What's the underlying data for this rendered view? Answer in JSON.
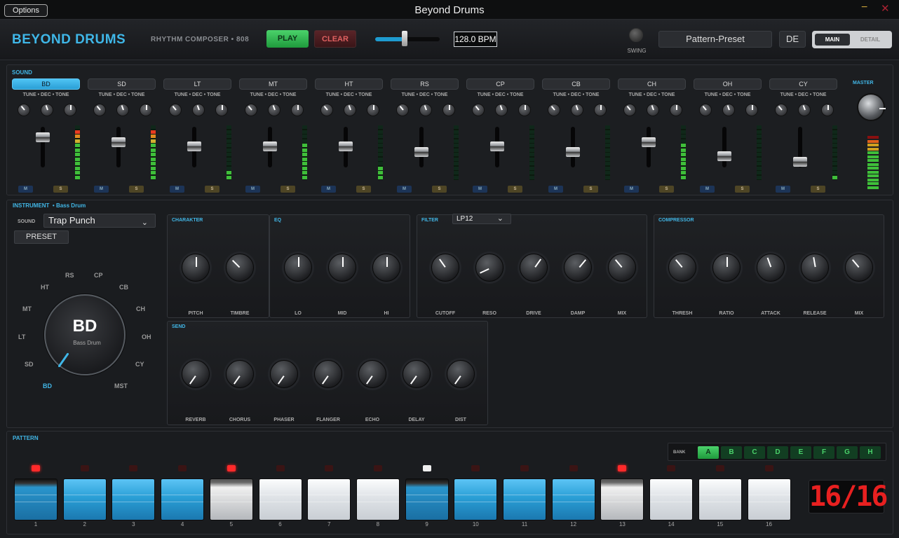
{
  "window": {
    "title": "Beyond Drums",
    "options_label": "Options",
    "minimize_glyph": "−",
    "close_glyph": "✕"
  },
  "header": {
    "brand": "BEYOND DRUMS",
    "subtitle": "RHYTHM COMPOSER • 808",
    "play_label": "PLAY",
    "clear_label": "CLEAR",
    "tempo_fraction": 0.43,
    "bpm": "128.0 BPM",
    "swing_label": "SWING",
    "preset": "Pattern-Preset",
    "language": "DE",
    "mode_main": "MAIN",
    "mode_detail": "DETAIL"
  },
  "sound": {
    "title": "SOUND",
    "knob_labels": "TUNE • DEC • TONE",
    "mute_label": "M",
    "solo_label": "S",
    "master_label": "MASTER",
    "channels": [
      {
        "name": "BD",
        "active": true,
        "fader": 0.85,
        "meter": 0.95
      },
      {
        "name": "SD",
        "active": false,
        "fader": 0.72,
        "meter": 0.9
      },
      {
        "name": "LT",
        "active": false,
        "fader": 0.62,
        "meter": 0.15
      },
      {
        "name": "MT",
        "active": false,
        "fader": 0.62,
        "meter": 0.7
      },
      {
        "name": "HT",
        "active": false,
        "fader": 0.62,
        "meter": 0.25
      },
      {
        "name": "RS",
        "active": false,
        "fader": 0.47,
        "meter": 0
      },
      {
        "name": "CP",
        "active": false,
        "fader": 0.62,
        "meter": 0
      },
      {
        "name": "CB",
        "active": false,
        "fader": 0.47,
        "meter": 0
      },
      {
        "name": "CH",
        "active": false,
        "fader": 0.72,
        "meter": 0.65
      },
      {
        "name": "OH",
        "active": false,
        "fader": 0.35,
        "meter": 0
      },
      {
        "name": "CY",
        "active": false,
        "fader": 0.2,
        "meter": 0.08
      }
    ]
  },
  "instrument": {
    "title": "INSTRUMENT",
    "bullet": "•",
    "current": "Bass Drum",
    "sound_label": "SOUND",
    "sound_value": "Trap Punch",
    "preset_label": "PRESET",
    "wheel": {
      "name": "BD",
      "sub": "Bass Drum",
      "labels": [
        "RS",
        "CP",
        "HT",
        "CB",
        "MT",
        "CH",
        "LT",
        "OH",
        "SD",
        "CY",
        "BD",
        "MST"
      ]
    },
    "sections": {
      "charakter": {
        "title": "CHARAKTER",
        "knobs": [
          "PITCH",
          "TIMBRE"
        ]
      },
      "eq": {
        "title": "EQ",
        "knobs": [
          "LO",
          "MID",
          "HI"
        ]
      },
      "filter": {
        "title": "FILTER",
        "type": "LP12",
        "knobs": [
          "CUTOFF",
          "RESO",
          "DRIVE",
          "DAMP",
          "MIX"
        ]
      },
      "compressor": {
        "title": "COMPRESSOR",
        "knobs": [
          "THRESH",
          "RATIO",
          "ATTACK",
          "RELEASE",
          "MIX"
        ]
      },
      "send": {
        "title": "SEND",
        "knobs": [
          "REVERB",
          "CHORUS",
          "PHASER",
          "FLANGER",
          "ECHO",
          "DELAY",
          "DIST"
        ]
      }
    }
  },
  "pattern": {
    "title": "PATTERN",
    "bank_label": "BANK",
    "banks": [
      "A",
      "B",
      "C",
      "D",
      "E",
      "F",
      "G",
      "H"
    ],
    "active_bank": "A",
    "counter": "16/16",
    "steps": [
      "1",
      "2",
      "3",
      "4",
      "5",
      "6",
      "7",
      "8",
      "9",
      "10",
      "11",
      "12",
      "13",
      "14",
      "15",
      "16"
    ]
  }
}
